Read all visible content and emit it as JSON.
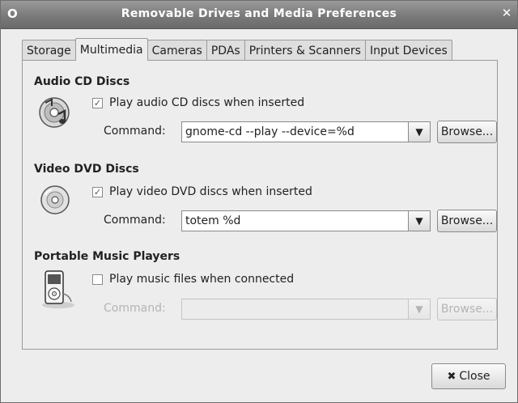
{
  "window": {
    "title": "Removable Drives and Media Preferences",
    "menu_glyph": "O",
    "close_glyph": "✕"
  },
  "tabs": [
    {
      "label": "Storage"
    },
    {
      "label": "Multimedia"
    },
    {
      "label": "Cameras"
    },
    {
      "label": "PDAs"
    },
    {
      "label": "Printers & Scanners"
    },
    {
      "label": "Input Devices"
    }
  ],
  "audio": {
    "title": "Audio CD Discs",
    "checkbox_label": "Play audio CD discs when inserted",
    "checked": true,
    "command_label": "Command:",
    "command_value": "gnome-cd --play --device=%d",
    "browse_label": "Browse..."
  },
  "video": {
    "title": "Video DVD Discs",
    "checkbox_label": "Play video DVD discs when inserted",
    "checked": true,
    "command_label": "Command:",
    "command_value": "totem %d",
    "browse_label": "Browse..."
  },
  "music": {
    "title": "Portable Music Players",
    "checkbox_label": "Play music files when connected",
    "checked": false,
    "command_label": "Command:",
    "command_value": "",
    "browse_label": "Browse..."
  },
  "footer": {
    "close_label": "Close",
    "close_glyph": "✖"
  }
}
